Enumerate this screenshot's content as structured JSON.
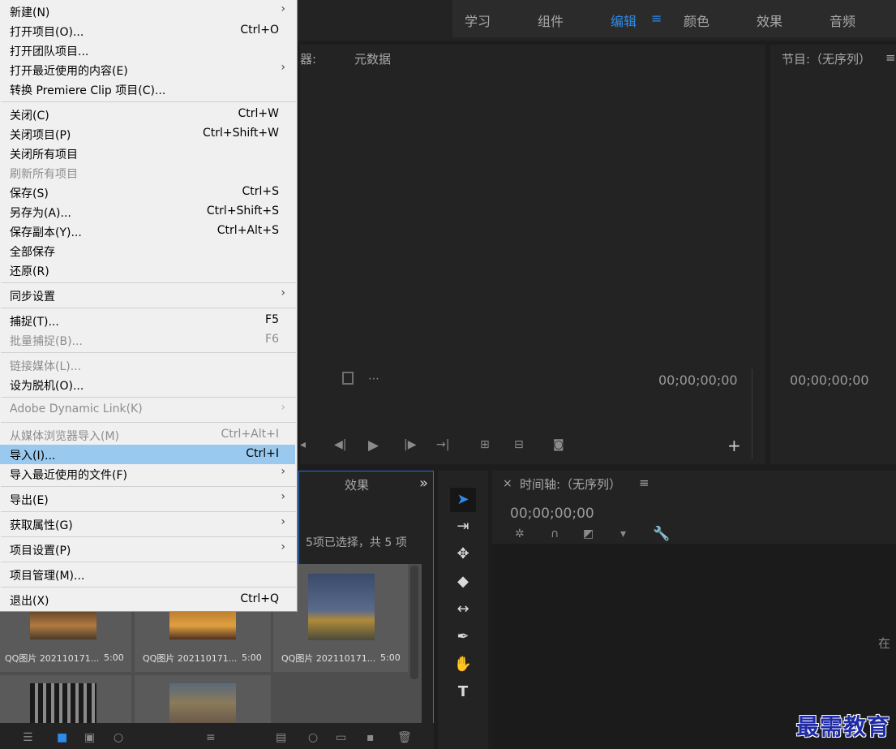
{
  "workspaces": {
    "tabs": [
      {
        "label": "学习"
      },
      {
        "label": "组件"
      },
      {
        "label": "编辑"
      },
      {
        "label": "颜色"
      },
      {
        "label": "效果"
      },
      {
        "label": "音频"
      }
    ],
    "active": "编辑",
    "menu_icon": "≡"
  },
  "source_panel": {
    "title_fragment": "器:",
    "metadata_tab": "元数据",
    "timecode": "00;00;00;00"
  },
  "program_panel": {
    "title": "节目:（无序列）",
    "menu_icon": "≡",
    "timecode": "00;00;00;00"
  },
  "project_panel": {
    "effects_tab": "效果",
    "more_icon": "»",
    "selection_status": "5项已选择，共 5 项",
    "items": [
      {
        "name": "QQ图片 202110171...",
        "duration": "5:00"
      },
      {
        "name": "QQ图片 202110171...",
        "duration": "5:00"
      },
      {
        "name": "QQ图片 202110171...",
        "duration": "5:00"
      }
    ]
  },
  "timeline_panel": {
    "close": "×",
    "title": "时间轴:（无序列）",
    "menu_icon": "≡",
    "timecode": "00;00;00;00",
    "edge_text": "在"
  },
  "file_menu": {
    "items": [
      {
        "label": "新建(N)",
        "shortcut": "",
        "submenu": "›"
      },
      {
        "label": "打开项目(O)...",
        "shortcut": "Ctrl+O"
      },
      {
        "label": "打开团队项目..."
      },
      {
        "label": "打开最近使用的内容(E)",
        "submenu": "›"
      },
      {
        "label": "转换 Premiere Clip 项目(C)..."
      },
      {
        "label": "关闭(C)",
        "shortcut": "Ctrl+W"
      },
      {
        "label": "关闭项目(P)",
        "shortcut": "Ctrl+Shift+W"
      },
      {
        "label": "关闭所有项目"
      },
      {
        "label": "刷新所有项目"
      },
      {
        "label": "保存(S)",
        "shortcut": "Ctrl+S"
      },
      {
        "label": "另存为(A)...",
        "shortcut": "Ctrl+Shift+S"
      },
      {
        "label": "保存副本(Y)...",
        "shortcut": "Ctrl+Alt+S"
      },
      {
        "label": "全部保存"
      },
      {
        "label": "还原(R)"
      },
      {
        "label": "同步设置",
        "submenu": "›"
      },
      {
        "label": "捕捉(T)...",
        "shortcut": "F5"
      },
      {
        "label": "批量捕捉(B)...",
        "shortcut": "F6"
      },
      {
        "label": "链接媒体(L)..."
      },
      {
        "label": "设为脱机(O)..."
      },
      {
        "label": "Adobe Dynamic Link(K)",
        "submenu": "›"
      },
      {
        "label": "从媒体浏览器导入(M)",
        "shortcut": "Ctrl+Alt+I"
      },
      {
        "label": "导入(I)...",
        "shortcut": "Ctrl+I"
      },
      {
        "label": "导入最近使用的文件(F)",
        "submenu": "›"
      },
      {
        "label": "导出(E)",
        "submenu": "›"
      },
      {
        "label": "获取属性(G)",
        "submenu": "›"
      },
      {
        "label": "项目设置(P)",
        "submenu": "›"
      },
      {
        "label": "项目管理(M)..."
      },
      {
        "label": "退出(X)",
        "shortcut": "Ctrl+Q"
      }
    ]
  },
  "watermark": "最需教育",
  "colors": {
    "accent": "#2d8ceb",
    "menu_bg": "#f0f0f0",
    "menu_highlight": "#99c9ef",
    "panel_bg": "#232323"
  }
}
